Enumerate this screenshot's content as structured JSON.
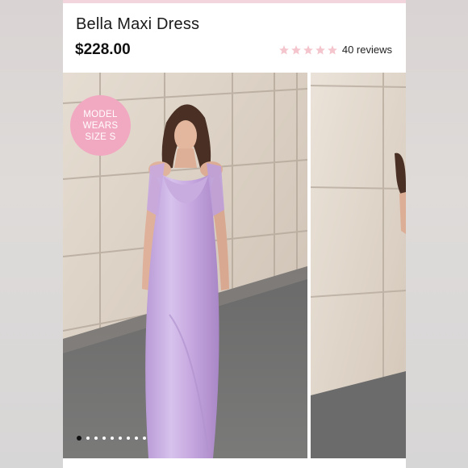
{
  "product": {
    "title": "Bella Maxi Dress",
    "price": "$228.00",
    "rating": 5,
    "reviews_label": "40 reviews",
    "star_color": "#f4c5cc"
  },
  "badge": {
    "line1": "MODEL",
    "line2": "WEARS",
    "line3": "SIZE S",
    "color": "#f1a8c1"
  },
  "carousel": {
    "total": 9,
    "active_index": 0
  }
}
